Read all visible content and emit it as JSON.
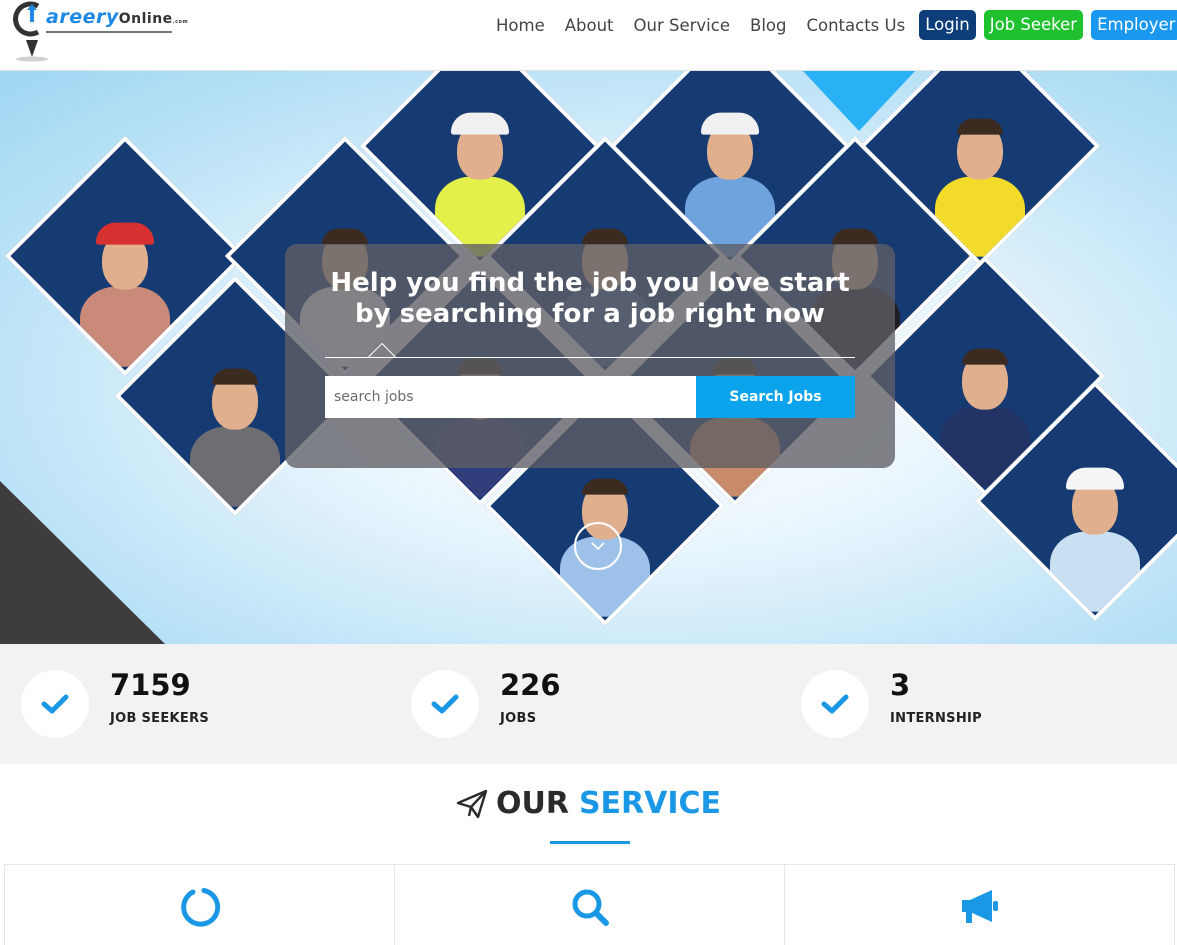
{
  "brand": {
    "logo_main": "areery",
    "logo_suffix": "Online",
    "logo_domain": ".com"
  },
  "nav": {
    "links": [
      "Home",
      "About",
      "Our Service",
      "Blog",
      "Contacts Us"
    ],
    "login": "Login",
    "job_seeker": "Job Seeker",
    "employer": "Employer"
  },
  "colors": {
    "login_bg": "#0d3e7a",
    "job_seeker_bg": "#1fc12f",
    "employer_bg": "#1a98f0",
    "accent": "#1a98e5",
    "tile_navy": "#163a72"
  },
  "hero": {
    "headline_line1": "Help you find the job you love start",
    "headline_line2": "by searching for a job right now",
    "search_placeholder": "search jobs",
    "search_button": "Search Jobs",
    "scroll_icon": "chevron-down-icon"
  },
  "stats": [
    {
      "value": "7159",
      "label": "JOB SEEKERS",
      "icon": "check-icon"
    },
    {
      "value": "226",
      "label": "JOBS",
      "icon": "check-icon"
    },
    {
      "value": "3",
      "label": "INTERNSHIP",
      "icon": "check-icon"
    }
  ],
  "service": {
    "heading_icon": "paper-plane-icon",
    "heading_word1": "OUR",
    "heading_word2": "SERVICE",
    "cards": [
      {
        "icon": "spinner-icon"
      },
      {
        "icon": "search-icon"
      },
      {
        "icon": "megaphone-icon"
      }
    ]
  }
}
